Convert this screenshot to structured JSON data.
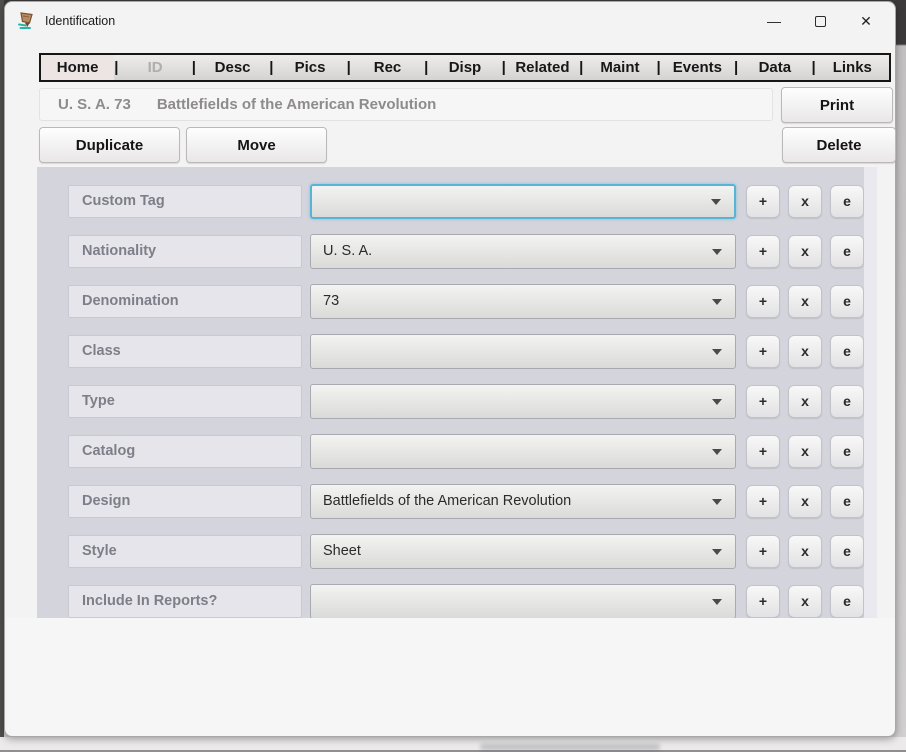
{
  "window": {
    "title": "Identification",
    "minimize_glyph": "—",
    "close_glyph": "✕"
  },
  "tab_separator": "|",
  "tabs": [
    {
      "label": "Home",
      "state": "active"
    },
    {
      "label": "ID",
      "state": "disabled"
    },
    {
      "label": "Desc",
      "state": "normal"
    },
    {
      "label": "Pics",
      "state": "normal"
    },
    {
      "label": "Rec",
      "state": "normal"
    },
    {
      "label": "Disp",
      "state": "normal"
    },
    {
      "label": "Related",
      "state": "normal"
    },
    {
      "label": "Maint",
      "state": "normal"
    },
    {
      "label": "Events",
      "state": "normal"
    },
    {
      "label": "Data",
      "state": "normal"
    },
    {
      "label": "Links",
      "state": "normal"
    }
  ],
  "record_header": {
    "id": "U. S. A. 73",
    "title": "Battlefields of the American Revolution"
  },
  "toolbar": {
    "print_label": "Print",
    "duplicate_label": "Duplicate",
    "move_label": "Move",
    "delete_label": "Delete"
  },
  "form": {
    "rows": [
      {
        "label": "Custom Tag",
        "value": "",
        "focused": true
      },
      {
        "label": "Nationality",
        "value": "U. S. A."
      },
      {
        "label": "Denomination",
        "value": "73"
      },
      {
        "label": "Class",
        "value": ""
      },
      {
        "label": "Type",
        "value": ""
      },
      {
        "label": "Catalog",
        "value": ""
      },
      {
        "label": "Design",
        "value": "Battlefields of the American Revolution"
      },
      {
        "label": "Style",
        "value": "Sheet"
      },
      {
        "label": "Include In Reports?",
        "value": ""
      }
    ],
    "row_buttons": {
      "add": "+",
      "remove": "x",
      "edit": "e"
    }
  },
  "colors": {
    "focus_border": "#57b4d5",
    "panel_bg": "#d4d4dc",
    "label_bg": "#e5e5eb",
    "tab_active_bg": "#ece5e3",
    "tab_disabled_text": "#b2adad"
  }
}
